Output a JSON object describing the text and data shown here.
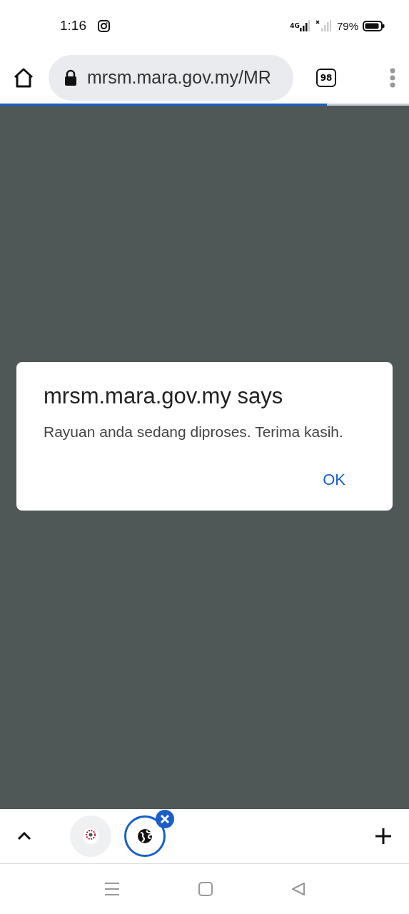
{
  "status_bar": {
    "time": "1:16",
    "network": "4G",
    "battery": "79%"
  },
  "toolbar": {
    "url": "mrsm.mara.gov.my/MR",
    "tab_count": "98"
  },
  "page_load": {
    "level": 0.8
  },
  "dialog": {
    "title": "mrsm.mara.gov.my says",
    "message": "Rayuan anda sedang diproses. Terima kasih.",
    "button": "OK"
  },
  "tab_strip": {
    "tabs": [
      {
        "kind": "logo",
        "selected": false
      },
      {
        "kind": "globe",
        "selected": true
      }
    ]
  }
}
